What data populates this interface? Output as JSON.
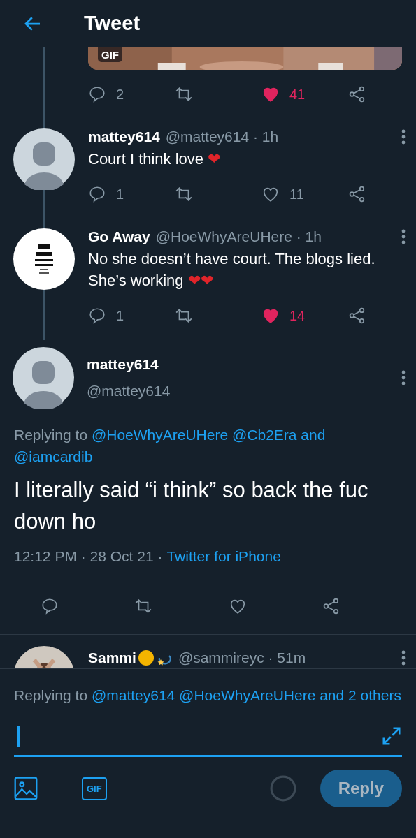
{
  "header": {
    "title": "Tweet"
  },
  "gif_preview": {
    "kind": "picture",
    "badge": "GIF"
  },
  "gif_actions": {
    "replies": "2",
    "likes": "41",
    "liked": true
  },
  "replies": [
    {
      "name": "mattey614",
      "handle": "@mattey614",
      "time": "· 1h",
      "avatar": {
        "kind": "default"
      },
      "text": "Court I think love",
      "emoji": "❤",
      "replies": "1",
      "likes": "11",
      "liked": false
    },
    {
      "name": "Go Away",
      "handle": "@HoeWhyAreUHere",
      "time": "· 1h",
      "text": "No she doesn’t have court. The blogs lied. She’s working",
      "emoji": "❤❤",
      "replies": "1",
      "likes": "14",
      "liked": true
    }
  ],
  "main_tweet": {
    "name": "mattey614",
    "handle": "@mattey614",
    "replying_label": "Replying to",
    "replying_to": [
      "@HoeWhyAreUHere",
      "@Cb2Era",
      "and",
      "@iamcardib"
    ],
    "text": "I literally said “i think” so back the fuc down ho",
    "time": "12:12 PM · 28 Oct 21 ·",
    "source": "Twitter for iPhone",
    "liked": false
  },
  "next_reply": {
    "name": "Sammi",
    "handle": "@sammireyc",
    "time": "· 51m"
  },
  "composer": {
    "replying_label": "Replying to",
    "replying_to": "@mattey614 @HoeWhyAreUHere and 2 others",
    "gif_button": "GIF",
    "reply_button": "Reply",
    "reply_disabled": true
  }
}
